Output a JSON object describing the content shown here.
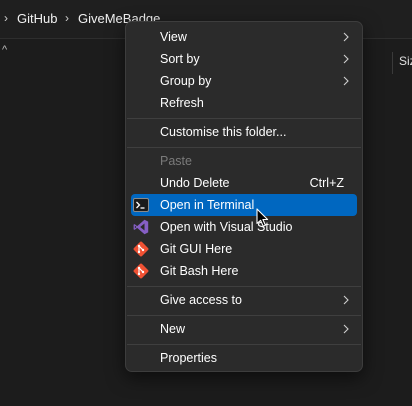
{
  "address_bar": {
    "separator": "›",
    "crumbs": [
      "GitHub",
      "GiveMeBadge"
    ]
  },
  "column_header": {
    "sort_indicator": "^",
    "size_label": "Siz"
  },
  "context_menu": {
    "items": {
      "view": {
        "label": "View",
        "has_submenu": true
      },
      "sort_by": {
        "label": "Sort by",
        "has_submenu": true
      },
      "group_by": {
        "label": "Group by",
        "has_submenu": true
      },
      "refresh": {
        "label": "Refresh"
      },
      "customise": {
        "label": "Customise this folder..."
      },
      "paste": {
        "label": "Paste",
        "disabled": true
      },
      "undo_delete": {
        "label": "Undo Delete",
        "shortcut": "Ctrl+Z"
      },
      "open_terminal": {
        "label": "Open in Terminal",
        "icon": "terminal-icon",
        "highlighted": true
      },
      "open_vs": {
        "label": "Open with Visual Studio",
        "icon": "visual-studio-icon"
      },
      "git_gui": {
        "label": "Git GUI Here",
        "icon": "git-icon"
      },
      "git_bash": {
        "label": "Git Bash Here",
        "icon": "git-icon"
      },
      "give_access": {
        "label": "Give access to",
        "has_submenu": true
      },
      "new": {
        "label": "New",
        "has_submenu": true
      },
      "properties": {
        "label": "Properties"
      }
    }
  },
  "colors": {
    "background": "#1c1c1c",
    "menu_bg": "#2b2b2b",
    "highlight": "#0067c0",
    "disabled_text": "#7a7a7a",
    "vs_purple": "#865fc5",
    "git_orange": "#f05133"
  }
}
